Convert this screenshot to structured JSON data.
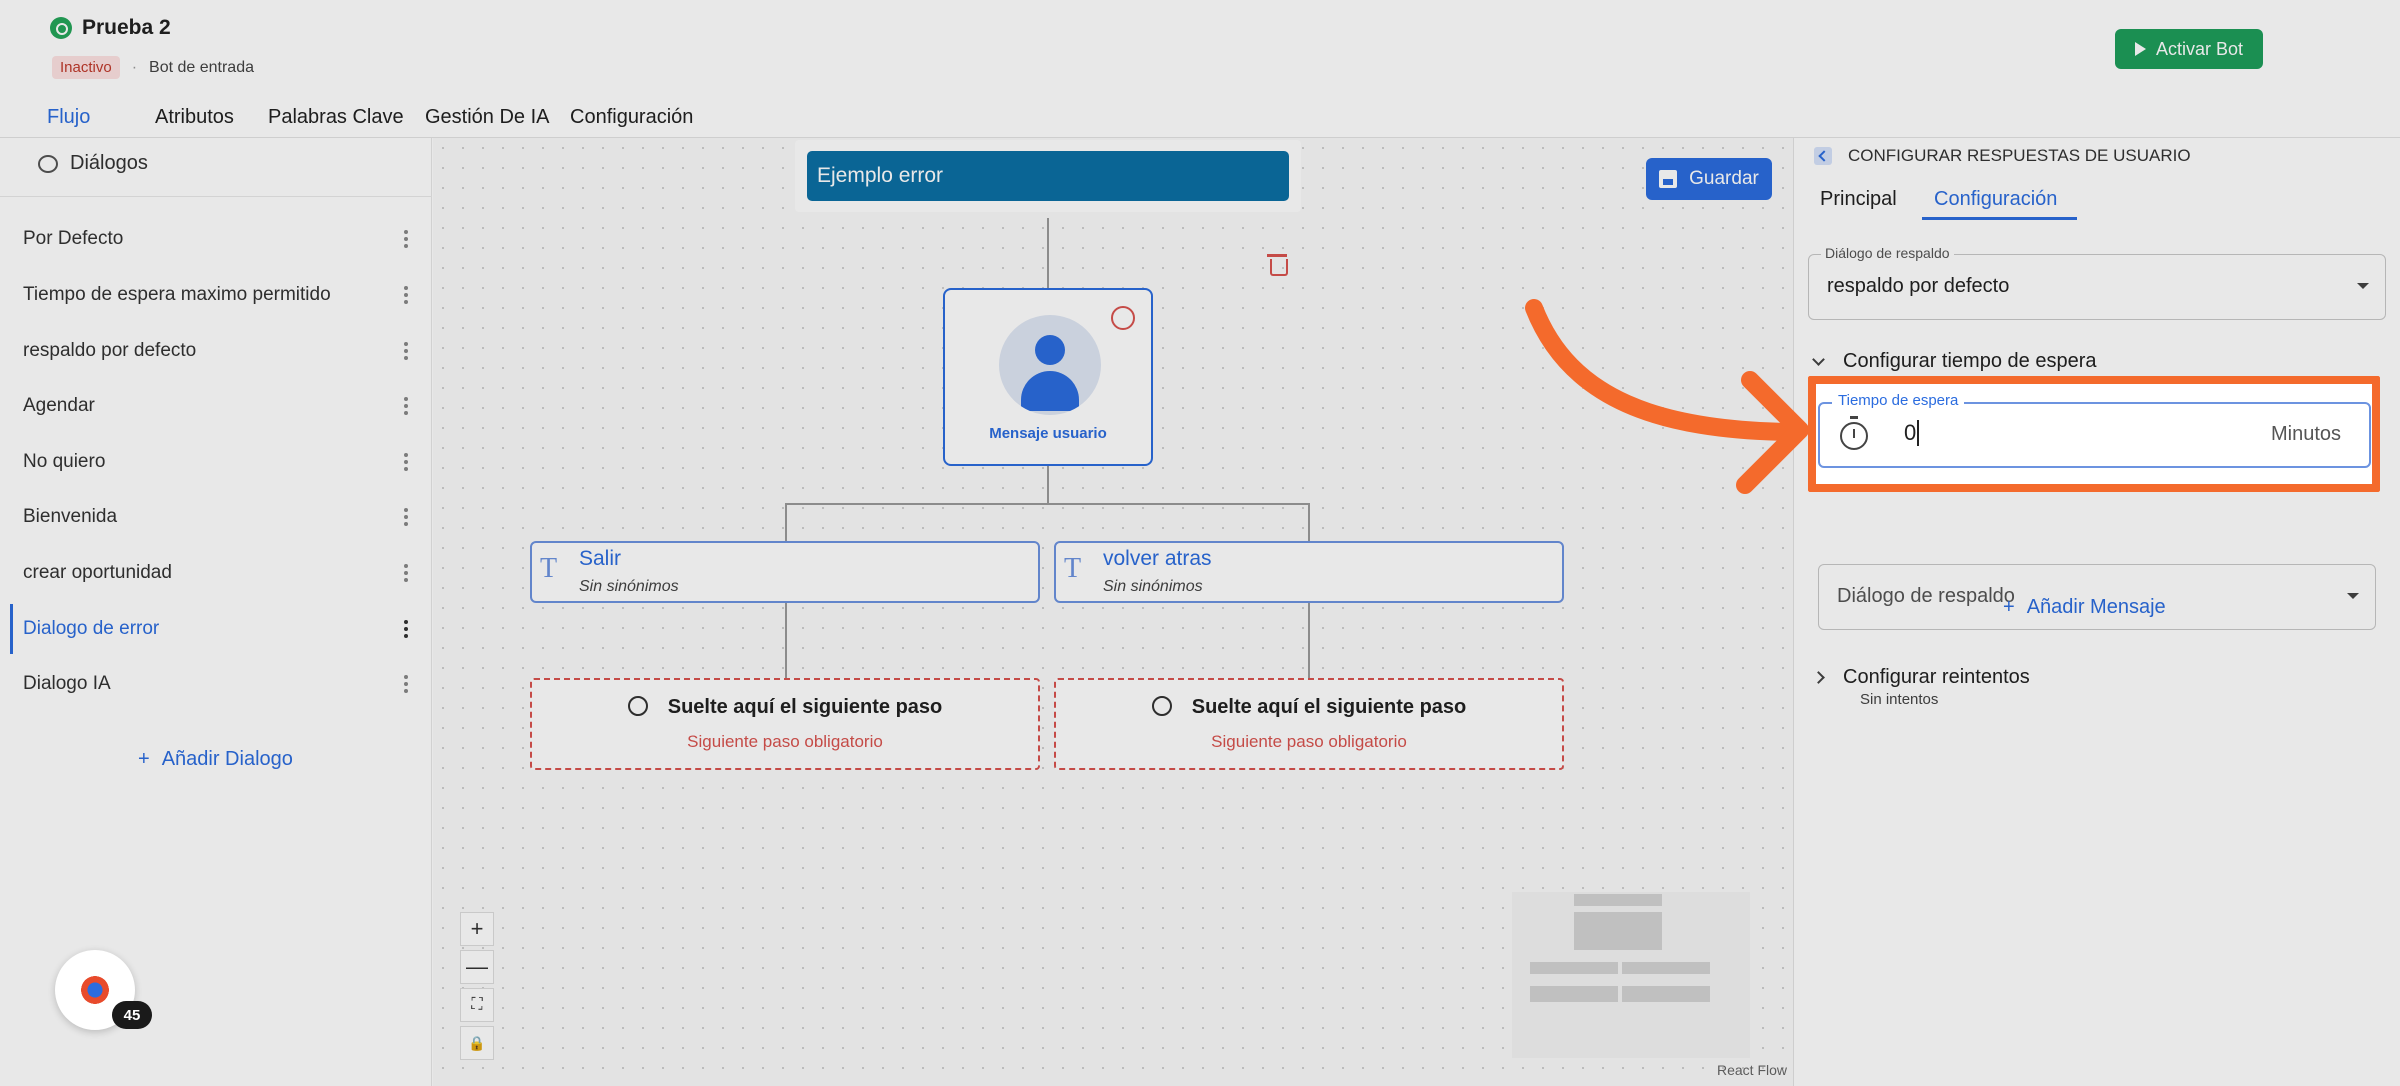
{
  "header": {
    "title": "Prueba 2",
    "status": "Inactivo",
    "separator": "·",
    "bot_type": "Bot de entrada",
    "activate_label": "Activar Bot"
  },
  "tabs": [
    {
      "label": "Flujo",
      "active": true
    },
    {
      "label": "Atributos",
      "active": false
    },
    {
      "label": "Palabras Clave",
      "active": false
    },
    {
      "label": "Gestión De IA",
      "active": false
    },
    {
      "label": "Configuración",
      "active": false
    }
  ],
  "sidebar": {
    "title": "Diálogos",
    "items": [
      {
        "label": "Por Defecto"
      },
      {
        "label": "Tiempo de espera maximo permitido"
      },
      {
        "label": "respaldo por defecto"
      },
      {
        "label": "Agendar"
      },
      {
        "label": "No quiero"
      },
      {
        "label": "Bienvenida"
      },
      {
        "label": "crear oportunidad"
      },
      {
        "label": "Dialogo de error",
        "active": true
      },
      {
        "label": "Dialogo IA"
      }
    ],
    "add_label": "Añadir Dialogo",
    "add_symbol": "+"
  },
  "canvas": {
    "node_title": "Ejemplo error",
    "save_label": "Guardar",
    "user_node_label": "Mensaje usuario",
    "options": [
      {
        "label": "Salir",
        "sub": "Sin sinónimos",
        "glyph": "T"
      },
      {
        "label": "volver atras",
        "sub": "Sin sinónimos",
        "glyph": "T"
      }
    ],
    "drop_zones": [
      {
        "title": "Suelte aquí el siguiente paso",
        "sub": "Siguiente paso obligatorio"
      },
      {
        "title": "Suelte aquí el siguiente paso",
        "sub": "Siguiente paso obligatorio"
      }
    ],
    "controls": {
      "zoom_in": "+",
      "zoom_out": "—",
      "fit": "⛶",
      "lock": "🔒"
    },
    "attribution": "React Flow"
  },
  "panel": {
    "title": "CONFIGURAR RESPUESTAS DE USUARIO",
    "tabs": [
      {
        "label": "Principal",
        "active": false
      },
      {
        "label": "Configuración",
        "active": true
      }
    ],
    "fallback_field": {
      "label": "Diálogo de respaldo",
      "value": "respaldo por defecto"
    },
    "wait_section": "Configurar tiempo de espera",
    "wait_field": {
      "label": "Tiempo de espera",
      "value": "0",
      "unit": "Minutos"
    },
    "wait_fallback_placeholder": "Diálogo de respaldo",
    "add_message_label": "Añadir Mensaje",
    "add_message_symbol": "+",
    "retry_section": "Configurar reintentos",
    "retry_sub": "Sin intentos"
  },
  "fab": {
    "count": "45"
  },
  "colors": {
    "accent": "#2b6cdf",
    "success": "#1e9e5b",
    "danger": "#d9534f",
    "highlight": "#f46a2c",
    "node_header": "#0b6fa4"
  }
}
